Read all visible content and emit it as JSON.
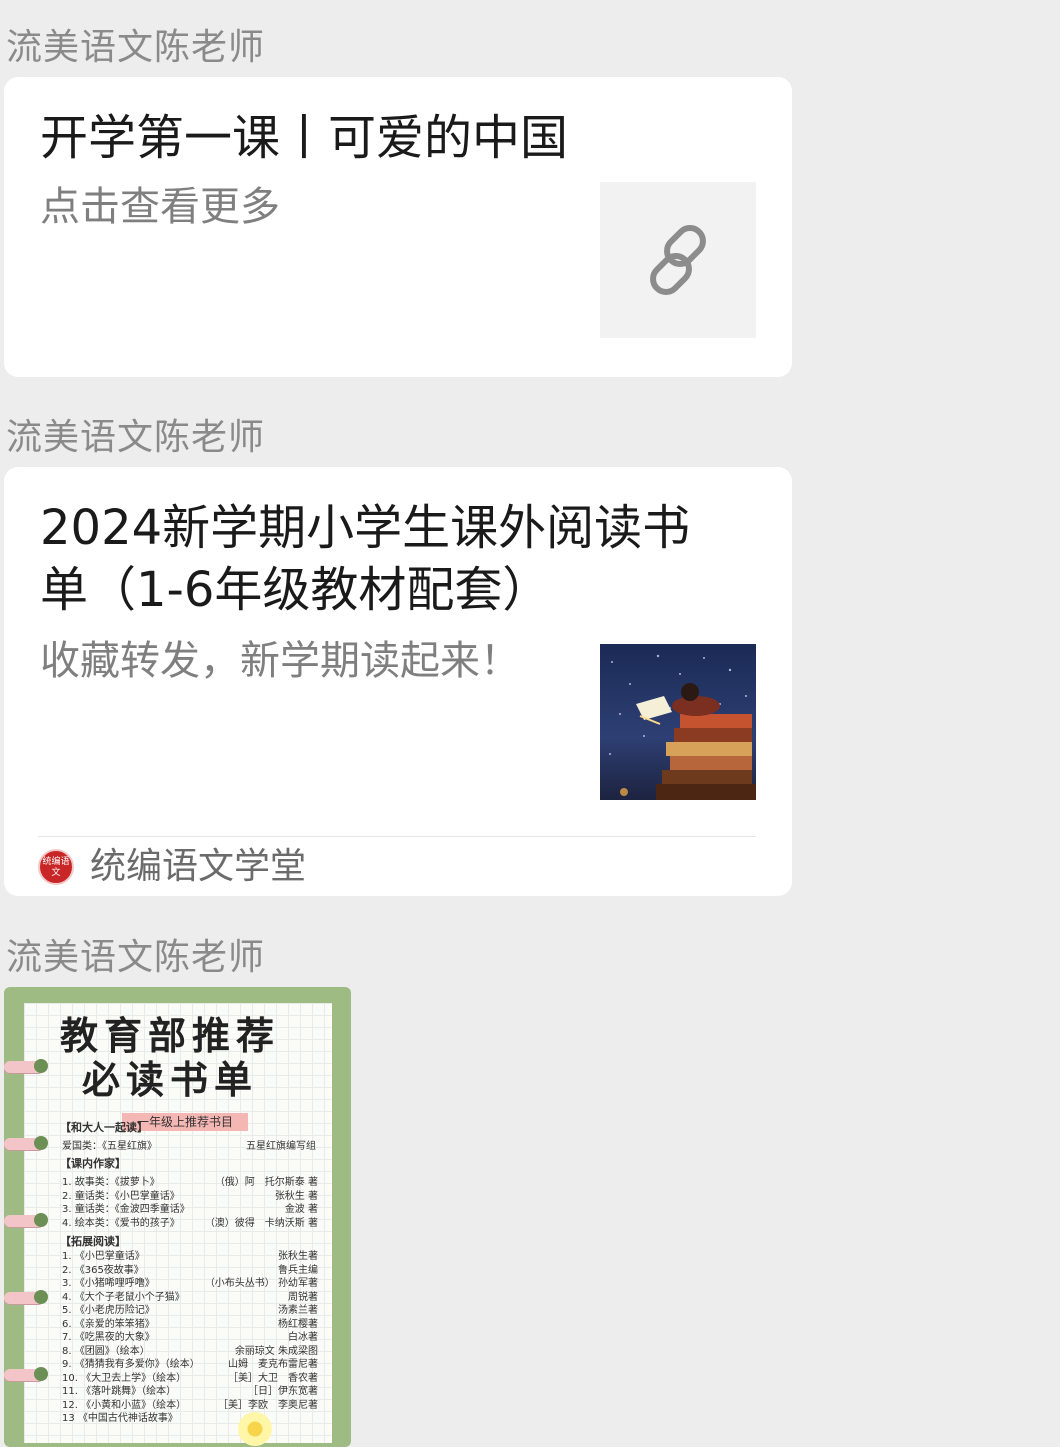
{
  "messages": [
    {
      "sender": "流美语文陈老师",
      "title": "开学第一课丨可爱的中国",
      "desc": "点击查看更多",
      "thumbnail": "link-icon"
    },
    {
      "sender": "流美语文陈老师",
      "title_line1": "2024新学期小学生课外阅读书",
      "title_line2": "单（1-6年级教材配套）",
      "desc": "收藏转发，新学期读起来！",
      "thumbnail": "child-reading-on-books-image",
      "source_logo_text": "统编语文",
      "source_name": "统编语文学堂"
    },
    {
      "sender": "流美语文陈老师",
      "image": {
        "title_line1": "教育部推荐",
        "title_line2": "必读书单",
        "subtitle": "一年级上推荐书目",
        "section1": "【和大人一起读】",
        "line1_left": "爱国类：《五星红旗》",
        "line1_right": "五星红旗编写组",
        "section2": "【课内作家】",
        "rows2": [
          {
            "left": "1. 故事类：《拔萝卜》",
            "right": "（俄）阿　托尔斯泰 著"
          },
          {
            "left": "2. 童话类：《小巴掌童话》",
            "right": "张秋生 著"
          },
          {
            "left": "3. 童话类：《金波四季童话》",
            "right": "金波 著"
          },
          {
            "left": "4. 绘本类：《爱书的孩子》",
            "right": "（澳）彼得　卡纳沃斯 著"
          }
        ],
        "section3": "【拓展阅读】",
        "rows3": [
          {
            "left": "1. 《小巴掌童话》",
            "right": "张秋生著"
          },
          {
            "left": "2. 《365夜故事》",
            "right": "鲁兵主编"
          },
          {
            "left": "3. 《小猪唏哩呼噜》",
            "right": "（小布头丛书） 孙幼军著"
          },
          {
            "left": "4. 《大个子老鼠小个子猫》",
            "right": "周锐著"
          },
          {
            "left": "5. 《小老虎历险记》",
            "right": "汤素兰著"
          },
          {
            "left": "6. 《亲爱的笨笨猪》",
            "right": "杨红樱著"
          },
          {
            "left": "7. 《吃黑夜的大象》",
            "right": "白冰著"
          },
          {
            "left": "8. 《团圆》（绘本）",
            "right": "余丽琼文 朱成梁图"
          },
          {
            "left": "9. 《猜猜我有多爱你》（绘本）",
            "right": "山姆　麦克布雷尼著"
          },
          {
            "left": "10. 《大卫去上学》（绘本）",
            "right": "［美］大卫　香农著"
          },
          {
            "left": "11. 《落叶跳舞》（绘本）",
            "right": "［日］伊东宽著"
          },
          {
            "left": "12. 《小黄和小蓝》（绘本）",
            "right": "［美］李欧　李奥尼著"
          },
          {
            "left": "13 《中国古代神话故事》",
            "right": ""
          }
        ]
      }
    }
  ],
  "colors": {
    "background": "#ededed",
    "card": "#ffffff",
    "sender_text": "#8a8a8a",
    "title_text": "#1a1a1a",
    "desc_text": "#7f7f7f"
  }
}
